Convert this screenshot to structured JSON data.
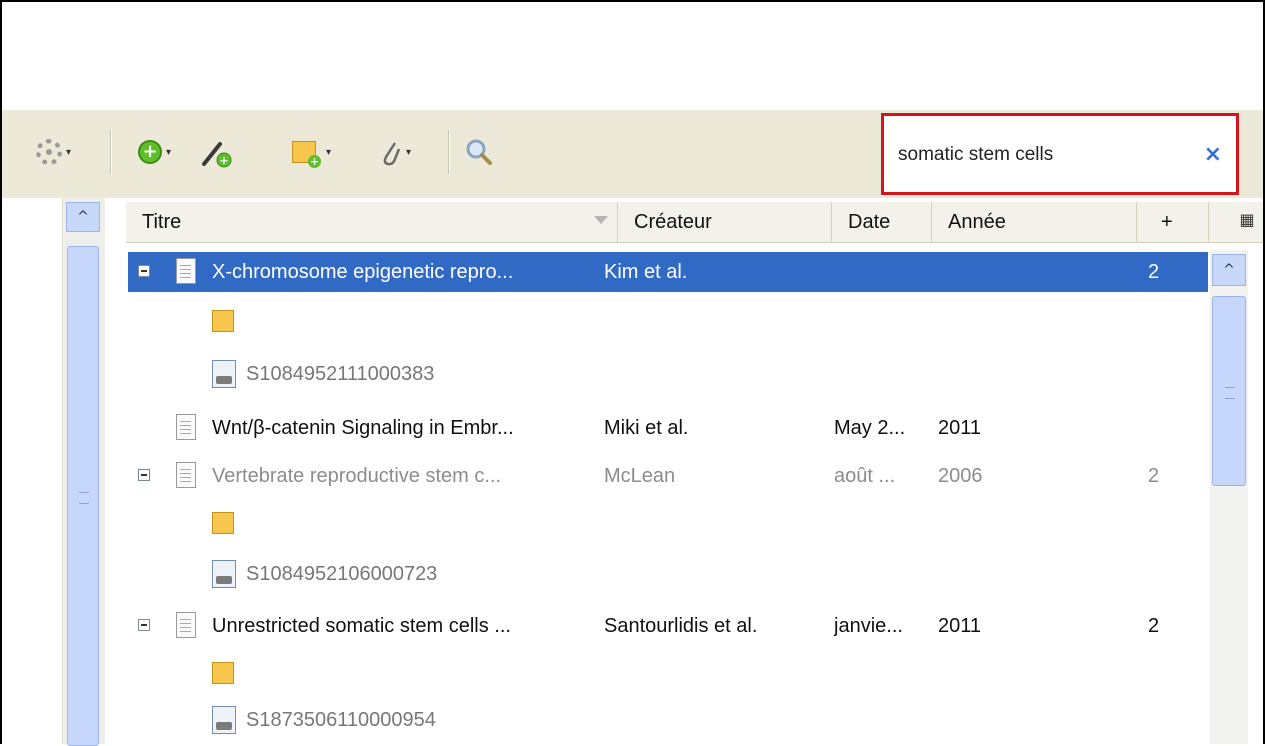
{
  "search": {
    "value": "somatic stem cells",
    "clear": "×"
  },
  "columns": {
    "title": "Titre",
    "creator": "Créateur",
    "date": "Date",
    "year": "Année",
    "notes": "+"
  },
  "toolbar": {
    "arrow": "▾"
  },
  "scroll": {
    "up": "^"
  },
  "rows": [
    {
      "title": "X-chromosome epigenetic repro...",
      "creator": "Kim et al.",
      "date": "",
      "year": "",
      "notes": "2"
    },
    {
      "attachment": "S1084952111000383"
    },
    {
      "title": "Wnt/β-catenin Signaling in Embr...",
      "creator": "Miki et al.",
      "date": "May 2...",
      "year": "2011",
      "notes": ""
    },
    {
      "title": "Vertebrate reproductive stem c...",
      "creator": "McLean",
      "date": "août ...",
      "year": "2006",
      "notes": "2"
    },
    {
      "attachment": "S1084952106000723"
    },
    {
      "title": "Unrestricted somatic stem cells ...",
      "creator": "Santourlidis et al.",
      "date": "janvie...",
      "year": "2011",
      "notes": "2"
    },
    {
      "attachment": "S1873506110000954"
    }
  ]
}
